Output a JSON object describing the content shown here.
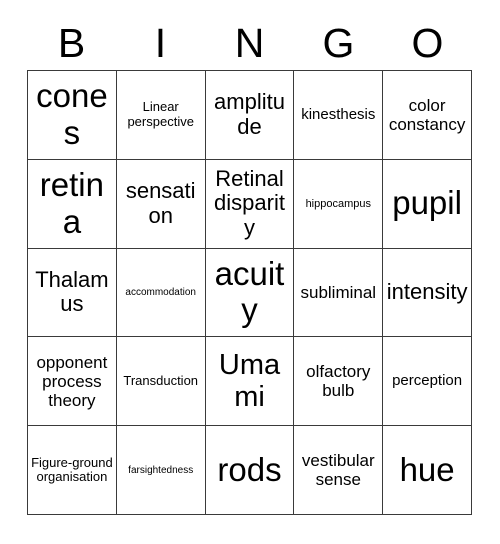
{
  "header": {
    "letters": [
      "B",
      "I",
      "N",
      "G",
      "O"
    ]
  },
  "grid": {
    "columns": 5,
    "rows": 5,
    "border_color": "#3a3a3a",
    "background_color": "#ffffff",
    "text_color": "#000000",
    "cells": [
      {
        "text": "cones",
        "size": "fs-xxl"
      },
      {
        "text": "Linear perspective",
        "size": "fs-xs"
      },
      {
        "text": "amplitude",
        "size": "fs-lg"
      },
      {
        "text": "kinesthesis",
        "size": "fs-sm"
      },
      {
        "text": "color constancy",
        "size": "fs-md"
      },
      {
        "text": "retina",
        "size": "fs-xxl"
      },
      {
        "text": "sensation",
        "size": "fs-lg"
      },
      {
        "text": "Retinal disparity",
        "size": "fs-lg"
      },
      {
        "text": "hippocampus",
        "size": "fs-xxs"
      },
      {
        "text": "pupil",
        "size": "fs-xxl"
      },
      {
        "text": "Thalamus",
        "size": "fs-lg"
      },
      {
        "text": "accommodation",
        "size": "fs-tiny"
      },
      {
        "text": "acuity",
        "size": "fs-xxl"
      },
      {
        "text": "subliminal",
        "size": "fs-md"
      },
      {
        "text": "intensity",
        "size": "fs-lg"
      },
      {
        "text": "opponent process theory",
        "size": "fs-md"
      },
      {
        "text": "Transduction",
        "size": "fs-xs"
      },
      {
        "text": "Umami",
        "size": "fs-xl"
      },
      {
        "text": "olfactory bulb",
        "size": "fs-md"
      },
      {
        "text": "perception",
        "size": "fs-sm"
      },
      {
        "text": "Figure-ground organisation",
        "size": "fs-xs"
      },
      {
        "text": "farsightedness",
        "size": "fs-tiny"
      },
      {
        "text": "rods",
        "size": "fs-xxl"
      },
      {
        "text": "vestibular sense",
        "size": "fs-md"
      },
      {
        "text": "hue",
        "size": "fs-xxl"
      }
    ]
  }
}
